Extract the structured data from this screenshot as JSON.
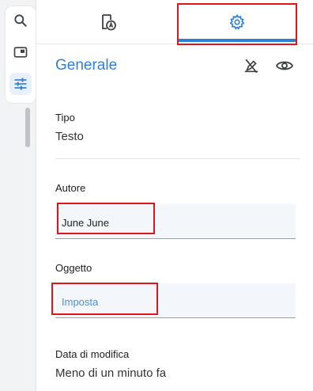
{
  "toolbar": {
    "items": [
      {
        "name": "search",
        "icon": "search-icon"
      },
      {
        "name": "panel",
        "icon": "window-icon"
      },
      {
        "name": "properties",
        "icon": "tune-icon",
        "active": true
      }
    ]
  },
  "tabs": [
    {
      "id": "info",
      "icon": "document-a-icon",
      "active": false
    },
    {
      "id": "settings",
      "icon": "gear-icon",
      "active": true
    }
  ],
  "section": {
    "title": "Generale",
    "actions": [
      {
        "id": "edit-disabled",
        "icon": "pen-off-icon"
      },
      {
        "id": "visibility",
        "icon": "eye-icon"
      }
    ]
  },
  "fields": {
    "type": {
      "label": "Tipo",
      "value": "Testo"
    },
    "author": {
      "label": "Autore",
      "value": "June June"
    },
    "subject": {
      "label": "Oggetto",
      "placeholder": "Imposta"
    },
    "modified": {
      "label": "Data di modifica",
      "value": "Meno di un minuto fa"
    }
  },
  "colors": {
    "accent": "#2f7fd6",
    "highlight": "#e0151b",
    "input_bg": "#f3f7fc"
  }
}
